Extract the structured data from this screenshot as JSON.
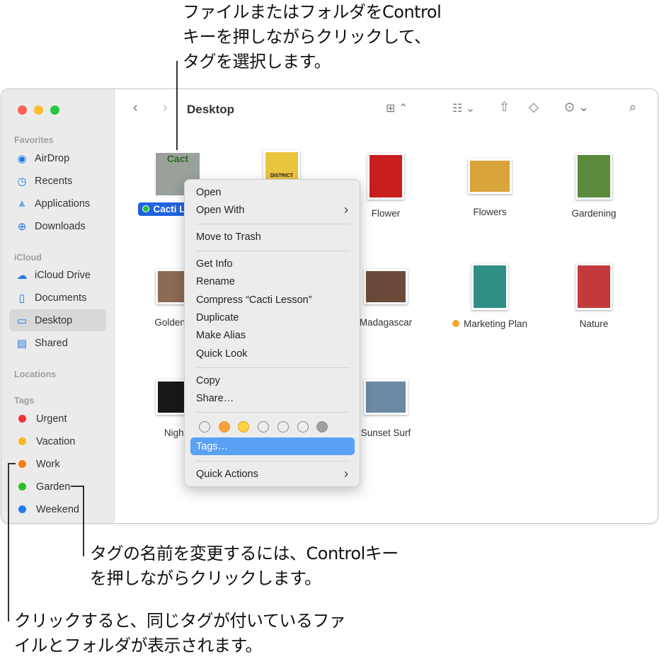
{
  "annotations": {
    "top": [
      "ファイルまたはフォルダをControl",
      "キーを押しながらクリックして、",
      "タグを選択します。"
    ],
    "rename": [
      "タグの名前を変更するには、Controlキー",
      "を押しながらクリックします。"
    ],
    "click": [
      "クリックすると、同じタグが付いているファ",
      "イルとフォルダが表示されます。"
    ]
  },
  "window": {
    "title": "Desktop",
    "traffic_colors": [
      "#fe5f57",
      "#febc2e",
      "#28c840"
    ]
  },
  "sidebar": {
    "favorites_heading": "Favorites",
    "favorites": [
      {
        "label": "AirDrop",
        "icon": "airdrop-icon",
        "glyph": "◉"
      },
      {
        "label": "Recents",
        "icon": "clock-icon",
        "glyph": "◷"
      },
      {
        "label": "Applications",
        "icon": "applications-icon",
        "glyph": "⩓"
      },
      {
        "label": "Downloads",
        "icon": "download-icon",
        "glyph": "⊕"
      }
    ],
    "icloud_heading": "iCloud",
    "icloud": [
      {
        "label": "iCloud Drive",
        "icon": "cloud-icon",
        "glyph": "☁"
      },
      {
        "label": "Documents",
        "icon": "document-icon",
        "glyph": "▯"
      },
      {
        "label": "Desktop",
        "icon": "desktop-icon",
        "glyph": "▭"
      },
      {
        "label": "Shared",
        "icon": "shared-folder-icon",
        "glyph": "▤"
      }
    ],
    "locations_heading": "Locations",
    "tags_heading": "Tags",
    "tags": [
      {
        "label": "Urgent",
        "color": "#f2303a"
      },
      {
        "label": "Vacation",
        "color": "#f8b81e"
      },
      {
        "label": "Work",
        "color": "#f57c16"
      },
      {
        "label": "Garden",
        "color": "#2bbf2e"
      },
      {
        "label": "Weekend",
        "color": "#1f7bf6"
      }
    ]
  },
  "files": [
    {
      "label": "Cacti Lesson",
      "tag": "#2bbf2e",
      "selected": true,
      "bg": "#9aa09a"
    },
    {
      "label": "",
      "bg": "#e9c43e"
    },
    {
      "label": "Flower",
      "bg": "#c81e1e"
    },
    {
      "label": "Flowers",
      "bg": "#d9a43a"
    },
    {
      "label": "Gardening",
      "bg": "#5b8a3c"
    },
    {
      "label": "Golden Ga",
      "bg": "#8c6a55"
    },
    {
      "label": "",
      "bg": "#fff"
    },
    {
      "label": "Madagascar",
      "bg": "#6b4a3a"
    },
    {
      "label": "Marketing Plan",
      "tag": "#f8a32a",
      "bg": "#2f8f86"
    },
    {
      "label": "Nature",
      "bg": "#c23a3a"
    },
    {
      "label": "Nightti",
      "bg": "#181818"
    },
    {
      "label": "",
      "bg": "#fff"
    },
    {
      "label": "Sunset Surf",
      "bg": "#6c8aa6"
    }
  ],
  "thumb_text": {
    "cacti": "Cact",
    "district": "DISTRICT"
  },
  "context_menu": {
    "items": [
      "Open",
      "Open With",
      "Move to Trash",
      "Get Info",
      "Rename",
      "Compress “Cacti Lesson”",
      "Duplicate",
      "Make Alias",
      "Quick Look",
      "Copy",
      "Share…",
      "Tags…",
      "Quick Actions"
    ],
    "tag_colors": [
      "none",
      "#f7a13c",
      "#fcd440",
      "none",
      "none",
      "none",
      "#a0a0a0"
    ]
  }
}
